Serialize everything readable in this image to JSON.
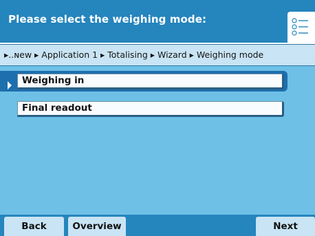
{
  "header": {
    "title": "Please select the weighing mode:",
    "menu_icon": "list-menu-icon"
  },
  "breadcrumb": {
    "text": "▸..ɴew ▸ Application 1 ▸ Totalising ▸ Wizard ▸ Weighing mode"
  },
  "options": [
    {
      "label": "Weighing in",
      "selected": true
    },
    {
      "label": "Final readout",
      "selected": false
    }
  ],
  "footer": {
    "back_label": "Back",
    "overview_label": "Overview",
    "next_label": "Next"
  },
  "colors": {
    "header_blue": "#2585bd",
    "content_blue": "#6ec0e6",
    "breadcrumb_bg": "#c9e4f4",
    "selection_blue": "#1d6fae"
  }
}
